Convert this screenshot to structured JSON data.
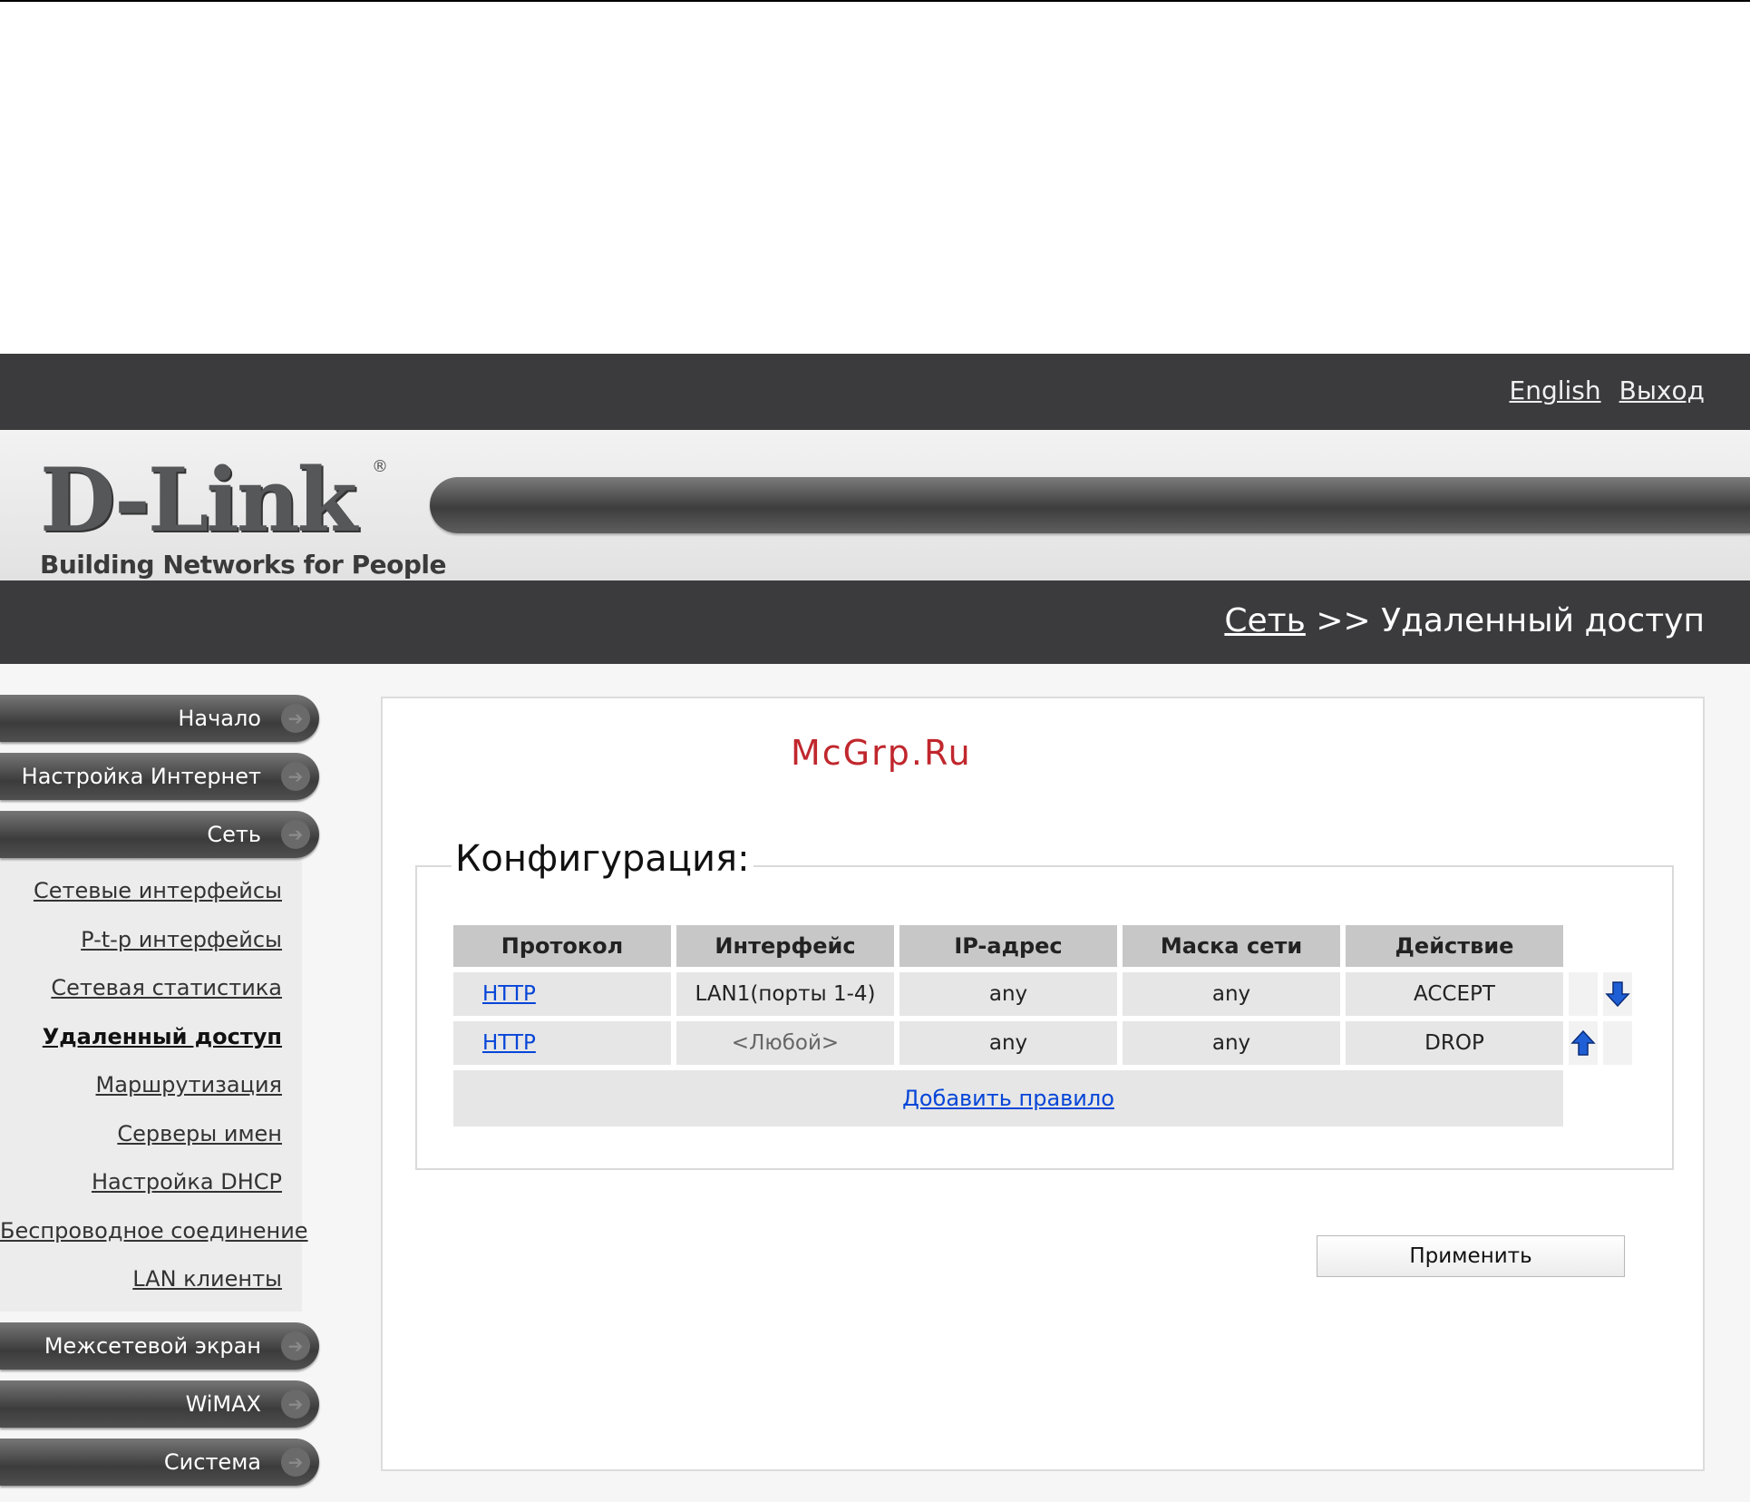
{
  "header": {
    "links": [
      {
        "label": "English"
      },
      {
        "label": "Выход"
      }
    ]
  },
  "logo": {
    "brand": "D-Link",
    "registered": "®",
    "tagline": "Building Networks for People"
  },
  "breadcrumb": {
    "parent": "Сеть",
    "separator": ">>",
    "current": "Удаленный доступ"
  },
  "sidebar": {
    "top_items": [
      {
        "label": "Начало"
      },
      {
        "label": "Настройка Интернет"
      },
      {
        "label": "Сеть"
      }
    ],
    "sub_items": [
      {
        "label": "Сетевые интерфейсы"
      },
      {
        "label": "P-t-p интерфейсы"
      },
      {
        "label": "Сетевая статистика"
      },
      {
        "label": "Удаленный доступ",
        "active": true
      },
      {
        "label": "Маршрутизация"
      },
      {
        "label": "Серверы имен"
      },
      {
        "label": "Настройка DHCP"
      },
      {
        "label": "Беспроводное соединение"
      },
      {
        "label": "LAN клиенты"
      }
    ],
    "bottom_items": [
      {
        "label": "Межсетевой экран"
      },
      {
        "label": "WiMAX"
      },
      {
        "label": "Система"
      }
    ]
  },
  "main": {
    "watermark": "McGrp.Ru",
    "section_title": "Конфигурация:",
    "table": {
      "headers": [
        "Протокол",
        "Интерфейс",
        "IP-адрес",
        "Маска сети",
        "Действие"
      ],
      "rows": [
        {
          "protocol": "HTTP",
          "interface": "LAN1(порты 1-4)",
          "ip": "any",
          "mask": "any",
          "action": "ACCEPT"
        },
        {
          "protocol": "HTTP",
          "interface": "<Любой>",
          "ip": "any",
          "mask": "any",
          "action": "DROP"
        }
      ],
      "add_rule": "Добавить правило"
    },
    "apply_label": "Применить"
  },
  "colors": {
    "bar": "#3b3b3d",
    "link": "#0645d8",
    "watermark": "#c0272d",
    "arrow": "#1f5fd6"
  }
}
